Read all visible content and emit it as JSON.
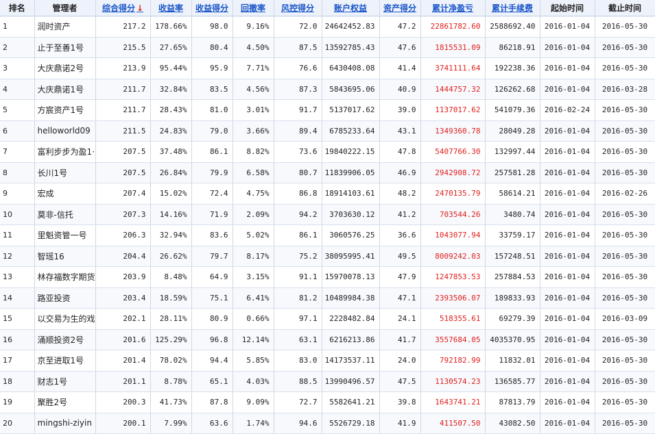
{
  "columns": [
    {
      "label": "排名",
      "sortable": false
    },
    {
      "label": "管理者",
      "sortable": false
    },
    {
      "label": "综合得分",
      "sortable": true,
      "sorted_desc": true
    },
    {
      "label": "收益率",
      "sortable": true
    },
    {
      "label": "收益得分",
      "sortable": true
    },
    {
      "label": "回撤率",
      "sortable": true
    },
    {
      "label": "风控得分",
      "sortable": true
    },
    {
      "label": "账户权益",
      "sortable": true
    },
    {
      "label": "资产得分",
      "sortable": true
    },
    {
      "label": "累计净盈亏",
      "sortable": true
    },
    {
      "label": "累计手续费",
      "sortable": true
    },
    {
      "label": "起始时间",
      "sortable": false
    },
    {
      "label": "截止时间",
      "sortable": false
    }
  ],
  "sort_arrow": "↓",
  "rows": [
    [
      "1",
      "润时资产",
      "217.2",
      "178.66%",
      "98.0",
      "9.16%",
      "72.0",
      "24642452.83",
      "47.2",
      "22861782.60",
      "2588692.40",
      "2016-01-04",
      "2016-05-30"
    ],
    [
      "2",
      "止于至善1号",
      "215.5",
      "27.65%",
      "80.4",
      "4.50%",
      "87.5",
      "13592785.43",
      "47.6",
      "1815531.09",
      "86218.91",
      "2016-01-04",
      "2016-05-30"
    ],
    [
      "3",
      "大庆鼎诺2号",
      "213.9",
      "95.44%",
      "95.9",
      "7.71%",
      "76.6",
      "6430408.08",
      "41.4",
      "3741111.64",
      "192238.36",
      "2016-01-04",
      "2016-05-30"
    ],
    [
      "4",
      "大庆鼎诺1号",
      "211.7",
      "32.84%",
      "83.5",
      "4.56%",
      "87.3",
      "5843695.06",
      "40.9",
      "1444757.32",
      "126262.68",
      "2016-01-04",
      "2016-03-28"
    ],
    [
      "5",
      "方宸资产1号",
      "211.7",
      "28.43%",
      "81.0",
      "3.01%",
      "91.7",
      "5137017.62",
      "39.0",
      "1137017.62",
      "541079.36",
      "2016-02-24",
      "2016-05-30"
    ],
    [
      "6",
      "helloworld09",
      "211.5",
      "24.83%",
      "79.0",
      "3.66%",
      "89.4",
      "6785233.64",
      "43.1",
      "1349360.78",
      "28049.28",
      "2016-01-04",
      "2016-05-30"
    ],
    [
      "7",
      "富利步步为盈1·",
      "207.5",
      "37.48%",
      "86.1",
      "8.82%",
      "73.6",
      "19840222.15",
      "47.8",
      "5407766.30",
      "132997.44",
      "2016-01-04",
      "2016-05-30"
    ],
    [
      "8",
      "长川1号",
      "207.5",
      "26.84%",
      "79.9",
      "6.58%",
      "80.7",
      "11839906.05",
      "46.9",
      "2942908.72",
      "257581.28",
      "2016-01-04",
      "2016-05-30"
    ],
    [
      "9",
      "宏成",
      "207.4",
      "15.02%",
      "72.4",
      "4.75%",
      "86.8",
      "18914103.61",
      "48.2",
      "2470135.79",
      "58614.21",
      "2016-01-04",
      "2016-02-26"
    ],
    [
      "10",
      "莫非-信托",
      "207.3",
      "14.16%",
      "71.9",
      "2.09%",
      "94.2",
      "3703630.12",
      "41.2",
      "703544.26",
      "3480.74",
      "2016-01-04",
      "2016-05-30"
    ],
    [
      "11",
      "里魁资管一号",
      "206.3",
      "32.94%",
      "83.6",
      "5.02%",
      "86.1",
      "3060576.25",
      "36.6",
      "1043077.94",
      "33759.17",
      "2016-01-04",
      "2016-05-30"
    ],
    [
      "12",
      "智瑶16",
      "204.4",
      "26.62%",
      "79.7",
      "8.17%",
      "75.2",
      "38095995.41",
      "49.5",
      "8009242.03",
      "157248.51",
      "2016-01-04",
      "2016-05-30"
    ],
    [
      "13",
      "林存福数字期货",
      "203.9",
      "8.48%",
      "64.9",
      "3.15%",
      "91.1",
      "15970078.13",
      "47.9",
      "1247853.53",
      "257884.53",
      "2016-01-04",
      "2016-05-30"
    ],
    [
      "14",
      "路亚投资",
      "203.4",
      "18.59%",
      "75.1",
      "6.41%",
      "81.2",
      "10489984.38",
      "47.1",
      "2393506.07",
      "189833.93",
      "2016-01-04",
      "2016-05-30"
    ],
    [
      "15",
      "以交易为生的戏",
      "202.1",
      "28.11%",
      "80.9",
      "0.66%",
      "97.1",
      "2228482.84",
      "24.1",
      "518355.61",
      "69279.39",
      "2016-01-04",
      "2016-03-09"
    ],
    [
      "16",
      "涌顺投资2号",
      "201.6",
      "125.29%",
      "96.8",
      "12.14%",
      "63.1",
      "6216213.86",
      "41.7",
      "3557684.05",
      "4035370.95",
      "2016-01-04",
      "2016-05-30"
    ],
    [
      "17",
      "京至进取1号",
      "201.4",
      "78.02%",
      "94.4",
      "5.85%",
      "83.0",
      "14173537.11",
      "24.0",
      "792182.99",
      "11832.01",
      "2016-01-04",
      "2016-05-30"
    ],
    [
      "18",
      "财志1号",
      "201.1",
      "8.78%",
      "65.1",
      "4.03%",
      "88.5",
      "13990496.57",
      "47.5",
      "1130574.23",
      "136585.77",
      "2016-01-04",
      "2016-05-30"
    ],
    [
      "19",
      "聚胜2号",
      "200.3",
      "41.73%",
      "87.8",
      "9.09%",
      "72.7",
      "5582641.21",
      "39.8",
      "1643741.21",
      "87813.79",
      "2016-01-04",
      "2016-05-30"
    ],
    [
      "20",
      "mingshi-ziyin",
      "200.1",
      "7.99%",
      "63.6",
      "1.74%",
      "94.6",
      "5526729.18",
      "41.9",
      "411507.50",
      "43082.50",
      "2016-01-04",
      "2016-05-30"
    ]
  ],
  "colors": {
    "header_link": "#1a55c8",
    "profit_red": "#e0201c",
    "sort_arrow": "#e8231a",
    "header_bg": "#eef3fb"
  }
}
